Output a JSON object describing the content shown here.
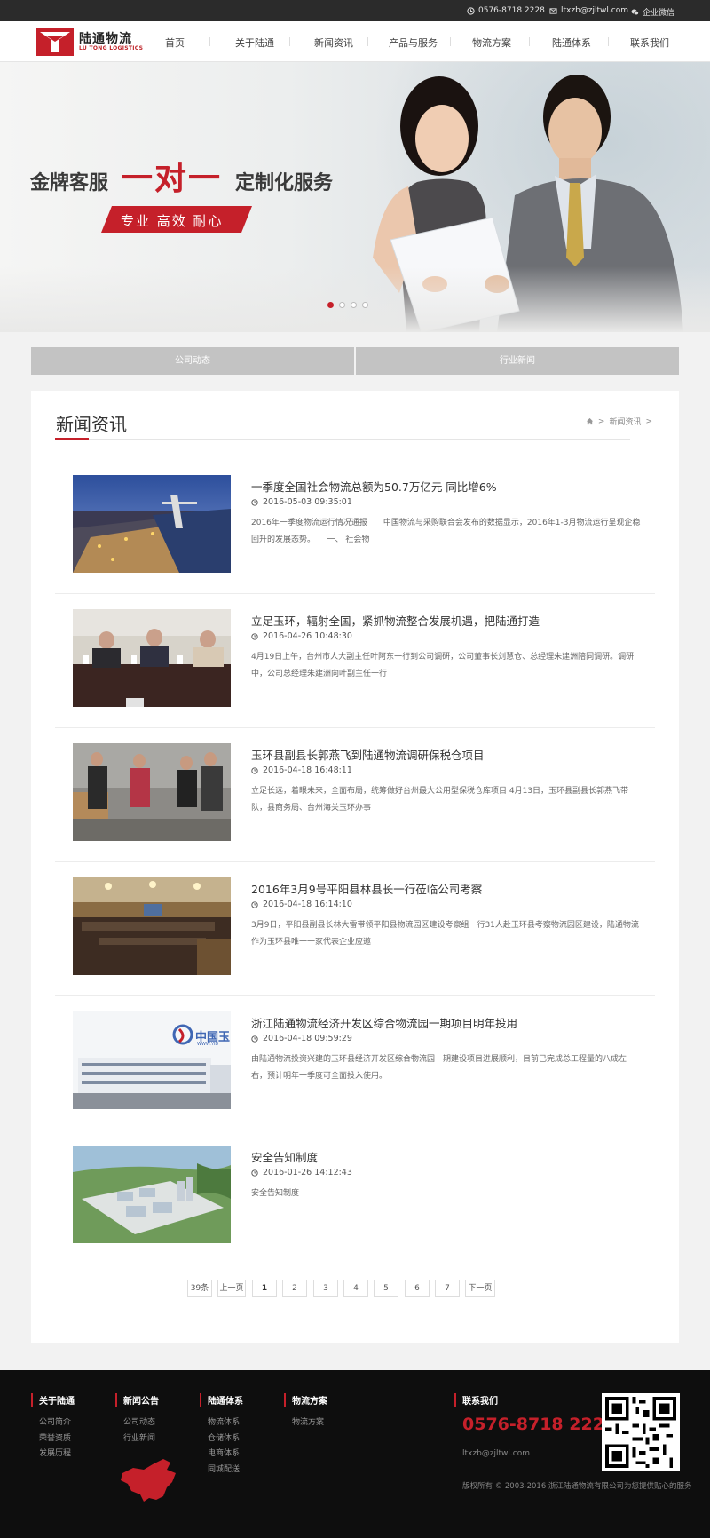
{
  "topbar": {
    "phone": "0576-8718 2228",
    "email": "ltxzb@zjltwl.com",
    "wechat": "企业微信"
  },
  "header": {
    "logo_cn": "陆通物流",
    "logo_en": "LU TONG LOGISTICS",
    "nav": [
      "首页",
      "关于陆通",
      "新闻资讯",
      "产品与服务",
      "物流方案",
      "陆通体系",
      "联系我们"
    ]
  },
  "banner": {
    "line_left": "金牌客服",
    "line_center": "一对一",
    "line_right": "定制化服务",
    "tag": "专业 高效 耐心",
    "slide_count": 4,
    "active_slide": 1
  },
  "tabs": [
    "公司动态",
    "行业新闻"
  ],
  "content": {
    "title": "新闻资讯",
    "breadcrumb": "新闻资讯",
    "news": [
      {
        "title": "一季度全国社会物流总额为50.7万亿元 同比增6%",
        "date": "2016-05-03 09:35:01",
        "summary": "2016年一季度物流运行情况通报　　中国物流与采购联合会发布的数据显示，2016年1-3月物流运行呈现企稳回升的发展态势。　　一、 社会物"
      },
      {
        "title": "立足玉环，辐射全国，紧抓物流整合发展机遇，把陆通打造",
        "date": "2016-04-26 10:48:30",
        "summary": "4月19日上午，台州市人大副主任叶阿东一行到公司调研，公司董事长刘慧仓、总经理朱建洲陪同调研。调研中，公司总经理朱建洲向叶副主任一行"
      },
      {
        "title": "玉环县副县长郭燕飞到陆通物流调研保税仓项目",
        "date": "2016-04-18 16:48:11",
        "summary": "立足长远，着眼未来，全面布局，统筹做好台州最大公用型保税仓库项目 4月13日，玉环县副县长郭燕飞带队，县商务局、台州海关玉环办事"
      },
      {
        "title": "2016年3月9号平阳县林县长一行莅临公司考察",
        "date": "2016-04-18 16:14:10",
        "summary": "3月9日，平阳县副县长林大雷带领平阳县物流园区建设考察组一行31人赴玉环县考察物流园区建设，陆通物流作为玉环县唯一一家代表企业应邀"
      },
      {
        "title": "浙江陆通物流经济开发区综合物流园一期项目明年投用",
        "date": "2016-04-18 09:59:29",
        "summary": "由陆通物流投资兴建的玉环县经济开发区综合物流园一期建设项目进展顺利，目前已完成总工程量的八成左右，预计明年一季度可全面投入使用。"
      },
      {
        "title": "安全告知制度",
        "date": "2016-01-26 14:12:43",
        "summary": "安全告知制度"
      }
    ],
    "thumb_text_5": "中国玉",
    "thumb_text_5b": "WWW.YID"
  },
  "pager": {
    "total": "39条",
    "prev": "上一页",
    "pages": [
      "1",
      "2",
      "3",
      "4",
      "5",
      "6",
      "7"
    ],
    "current": "1",
    "next": "下一页"
  },
  "footer": {
    "columns": [
      {
        "title": "关于陆通",
        "links": [
          "公司简介",
          "荣誉资质",
          "发展历程"
        ]
      },
      {
        "title": "新闻公告",
        "links": [
          "公司动态",
          "行业新闻"
        ]
      },
      {
        "title": "陆通体系",
        "links": [
          "物流体系",
          "仓储体系",
          "电商体系",
          "同城配送"
        ]
      },
      {
        "title": "物流方案",
        "links": [
          "物流方案"
        ]
      }
    ],
    "contact_title": "联系我们",
    "phone": "0576-8718 2228",
    "email": "ltxzb@zjltwl.com",
    "copyright": "版权所有 © 2003-2016 浙江陆通物流有限公司为您提供贴心的服务"
  },
  "colors": {
    "brand_red": "#c5202a",
    "topbar": "#2b2b2b",
    "footer": "#0e0e0e",
    "tab": "#c3c3c3"
  }
}
